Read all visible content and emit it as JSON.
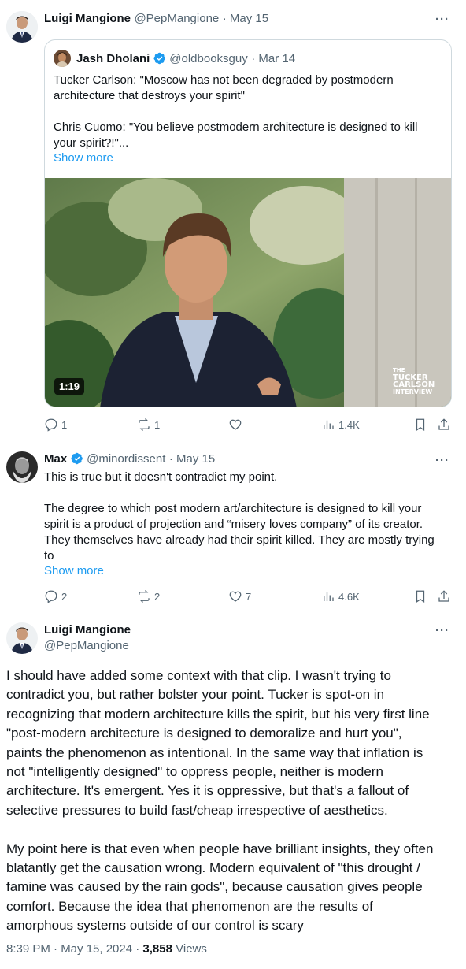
{
  "tweet1": {
    "name": "Luigi Mangione",
    "handle": "@PepMangione",
    "date": "· May 15",
    "more": "···",
    "quote": {
      "name": "Jash Dholani",
      "handle": "@oldbooksguy",
      "date": "· Mar 14",
      "text1": "Tucker Carlson: \"Moscow has not been degraded by postmodern",
      "text2": "architecture that destroys your spirit\"",
      "text3": "Chris Cuomo: \"You believe postmodern architecture is designed to kill",
      "text4": "your spirit?!\"...",
      "show_more": "Show more",
      "video_duration": "1:19",
      "watermark": [
        "THE",
        "TUCKER",
        "CARLSON",
        "INTERVIEW"
      ]
    },
    "actions": {
      "replies": "1",
      "reposts": "1",
      "likes": "",
      "views": "1.4K"
    }
  },
  "tweet2": {
    "name": "Max",
    "handle": "@minordissent",
    "date": "· May 15",
    "more": "···",
    "line1": "This is true but it doesn't contradict my point.",
    "lines": [
      "The degree to which post modern art/architecture is designed to kill your",
      "spirit is a product of projection and “misery loves company” of its creator.",
      "They themselves have already had their spirit killed. They are mostly trying",
      "to"
    ],
    "show_more": "Show more",
    "actions": {
      "replies": "2",
      "reposts": "2",
      "likes": "7",
      "views": "4.6K"
    }
  },
  "tweet3": {
    "name": "Luigi Mangione",
    "handle": "@PepMangione",
    "more": "···",
    "para1": [
      "I should have added some context with that clip. I wasn't trying to",
      "contradict you, but rather bolster your point. Tucker is spot-on in",
      "recognizing that modern architecture kills the spirit, but his very first line",
      "\"post-modern architecture is designed to demoralize and hurt you\",",
      "paints the phenomenon as intentional. In the same way that inflation is",
      "not \"intelligently designed\" to oppress people, neither is modern",
      "architecture. It's emergent. Yes it is oppressive, but that's a fallout of",
      "selective pressures to build fast/cheap irrespective of aesthetics."
    ],
    "para2": [
      "My point here is that even when people have brilliant insights, they often",
      "blatantly get the causation wrong. Modern equivalent of \"this drought /",
      "famine was caused by the rain gods\", because causation gives people",
      "comfort. Because the idea that phenomenon are the results of",
      "amorphous systems outside of our control is scary"
    ],
    "timestamp": "8:39 PM · May 15, 2024 · ",
    "views_count": "3,858",
    "views_label": " Views"
  },
  "colors": {
    "accent": "#1d9bf0",
    "muted": "#536471",
    "text": "#0f1419",
    "border": "#cfd9de"
  }
}
